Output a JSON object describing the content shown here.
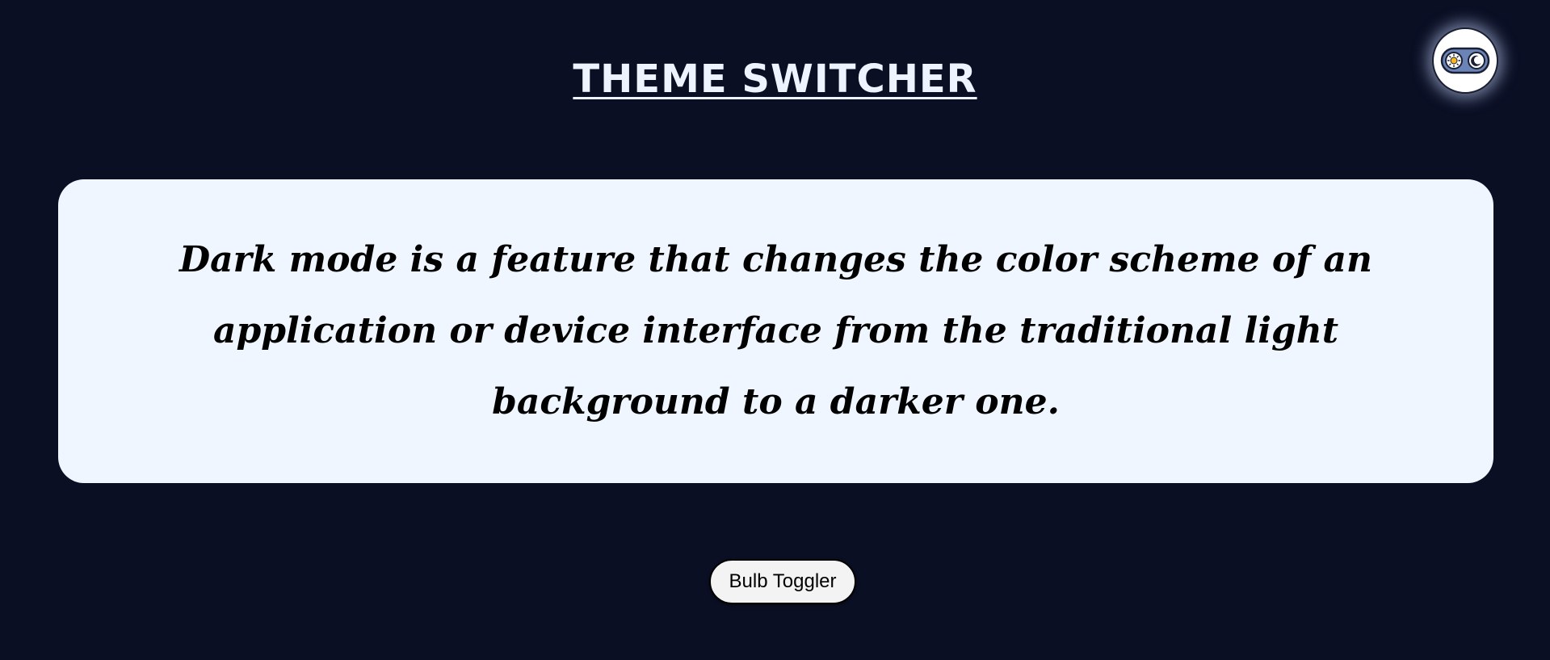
{
  "header": {
    "title": "THEME SWITCHER"
  },
  "theme_toggle": {
    "icon_left": "sun-icon",
    "icon_right": "moon-icon",
    "current_mode": "dark"
  },
  "card": {
    "text": "Dark mode is a feature that changes the color scheme of an application or device interface from the traditional light background to a darker one."
  },
  "actions": {
    "bulb_toggler_label": "Bulb Toggler"
  },
  "colors": {
    "page_background": "#0a0f24",
    "card_background": "#eff6ff",
    "title_color": "#eef4ff",
    "toggle_track": "#6b84b8",
    "sun_color": "#f5b820"
  }
}
